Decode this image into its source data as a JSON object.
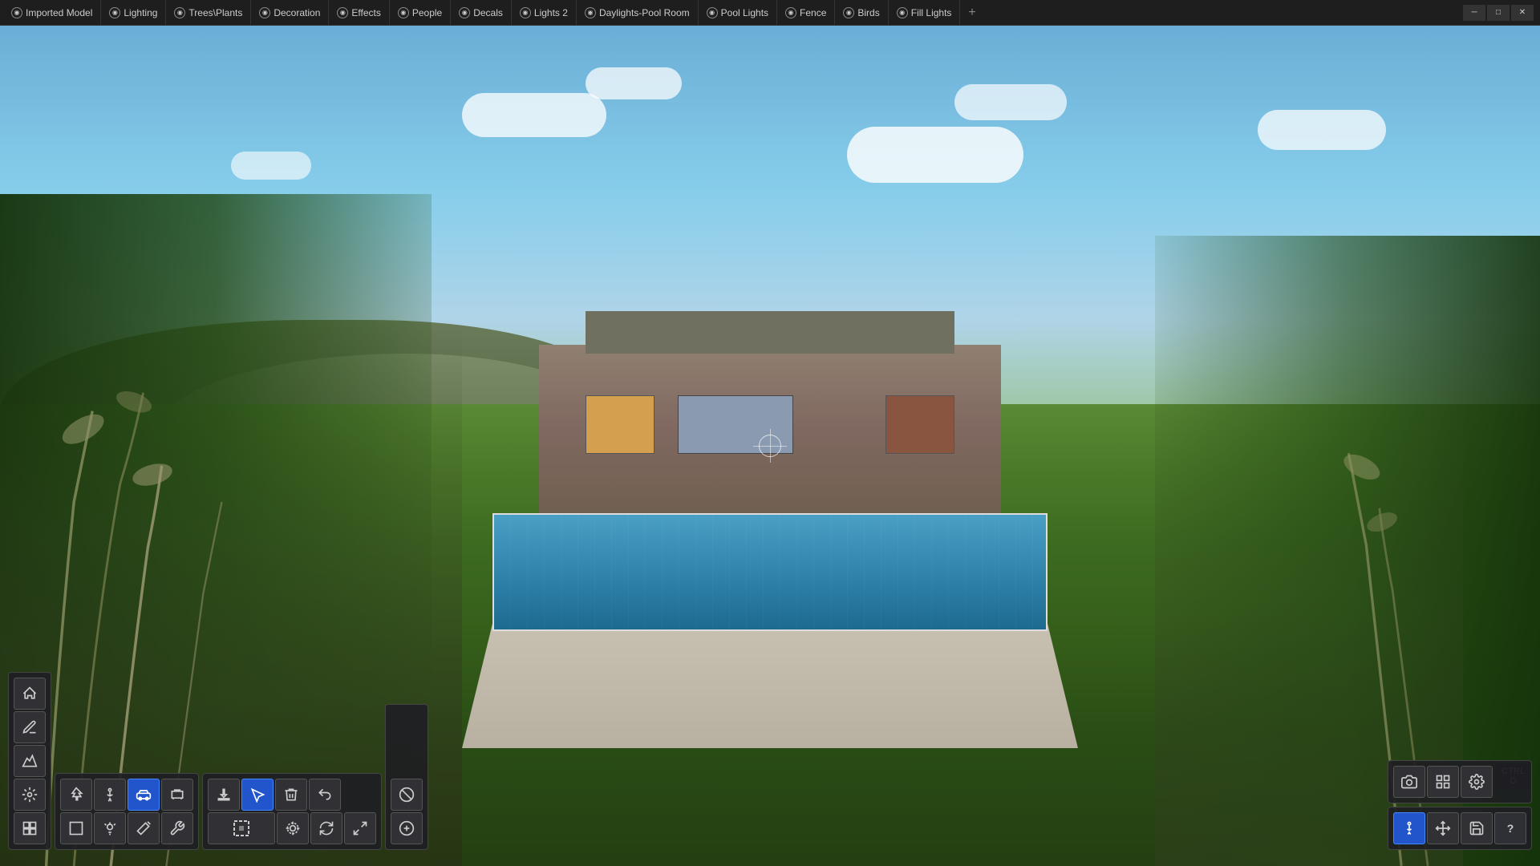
{
  "topbar": {
    "tabs": [
      {
        "id": "imported-model",
        "label": "Imported Model",
        "icon": "cube"
      },
      {
        "id": "lighting",
        "label": "Lighting",
        "icon": "sun"
      },
      {
        "id": "trees-plants",
        "label": "Trees\\Plants",
        "icon": "tree"
      },
      {
        "id": "decoration",
        "label": "Decoration",
        "icon": "star"
      },
      {
        "id": "effects",
        "label": "Effects",
        "icon": "sparkle"
      },
      {
        "id": "people",
        "label": "People",
        "icon": "person"
      },
      {
        "id": "decals",
        "label": "Decals",
        "icon": "decal"
      },
      {
        "id": "lights2",
        "label": "Lights 2",
        "icon": "bulb"
      },
      {
        "id": "daylights-pool-room",
        "label": "Daylights-Pool Room",
        "icon": "sun2"
      },
      {
        "id": "pool-lights",
        "label": "Pool Lights",
        "icon": "pool"
      },
      {
        "id": "fence",
        "label": "Fence",
        "icon": "fence"
      },
      {
        "id": "birds",
        "label": "Birds",
        "icon": "bird"
      },
      {
        "id": "fill-lights",
        "label": "Fill Lights",
        "icon": "fill"
      }
    ],
    "add_tab": "+",
    "window_controls": [
      "minimize",
      "maximize",
      "close"
    ]
  },
  "viewport": {
    "crosshair": true
  },
  "bottom_toolbar": {
    "nav_buttons": [
      {
        "id": "home",
        "icon": "⌂",
        "label": "home",
        "active": false
      },
      {
        "id": "paint",
        "icon": "✏",
        "label": "paint-brush",
        "active": false
      },
      {
        "id": "terrain",
        "icon": "▲",
        "label": "terrain",
        "active": false
      },
      {
        "id": "effects",
        "icon": "✦",
        "label": "effects",
        "active": false
      }
    ],
    "object_panel": {
      "rows": [
        [
          {
            "id": "tree",
            "icon": "🌲",
            "label": "tree-btn",
            "active": false
          },
          {
            "id": "person",
            "icon": "🚶",
            "label": "person-btn",
            "active": false
          },
          {
            "id": "car",
            "icon": "🚗",
            "label": "car-btn",
            "active": true
          },
          {
            "id": "furniture",
            "icon": "🪑",
            "label": "furniture-btn",
            "active": false
          }
        ],
        [
          {
            "id": "box",
            "icon": "☐",
            "label": "box-btn",
            "active": false
          },
          {
            "id": "light",
            "icon": "💡",
            "label": "light-btn",
            "active": false
          },
          {
            "id": "wand",
            "icon": "⚡",
            "label": "wand-btn",
            "active": false
          },
          {
            "id": "wrench",
            "icon": "🔧",
            "label": "wrench-btn",
            "active": false
          }
        ]
      ]
    },
    "transform_panel": {
      "top_row": [
        {
          "id": "download",
          "icon": "⬇",
          "label": "import-btn",
          "active": false
        },
        {
          "id": "select",
          "icon": "↖",
          "label": "select-btn",
          "active": true
        },
        {
          "id": "delete",
          "icon": "🗑",
          "label": "delete-btn",
          "active": false
        },
        {
          "id": "undo",
          "icon": "↩",
          "label": "undo-btn",
          "active": false
        }
      ],
      "bottom_row": [
        {
          "id": "bbox",
          "icon": "⊡",
          "label": "bounding-box-btn",
          "active": false
        },
        {
          "id": "snap",
          "icon": "⊕",
          "label": "snap-btn",
          "active": false
        },
        {
          "id": "rotate",
          "icon": "↻",
          "label": "rotate-btn",
          "active": false
        },
        {
          "id": "expand",
          "icon": "⤢",
          "label": "expand-btn",
          "active": false
        }
      ],
      "extra": [
        {
          "id": "extra1",
          "icon": "⊘",
          "label": "extra-btn-1",
          "active": false
        },
        {
          "id": "extra2",
          "icon": "⊗",
          "label": "extra-btn-2",
          "active": false
        }
      ]
    }
  },
  "right_toolbar": {
    "top_panel": [
      {
        "id": "camera",
        "icon": "📷",
        "label": "camera-btn",
        "active": false
      },
      {
        "id": "grid",
        "icon": "⊞",
        "label": "grid-btn",
        "active": false
      },
      {
        "id": "settings",
        "icon": "⚙",
        "label": "settings-btn",
        "active": false
      }
    ],
    "bottom_panel": [
      {
        "id": "figure",
        "icon": "🚶",
        "label": "figure-btn",
        "active": true
      },
      {
        "id": "arrows",
        "icon": "↔",
        "label": "arrows-btn",
        "active": false
      },
      {
        "id": "save",
        "icon": "💾",
        "label": "save-btn",
        "active": false
      },
      {
        "id": "help",
        "icon": "?",
        "label": "help-btn",
        "active": false
      }
    ]
  },
  "ctrl_indicator": {
    "label": "CTRL",
    "sub_label": "O"
  }
}
